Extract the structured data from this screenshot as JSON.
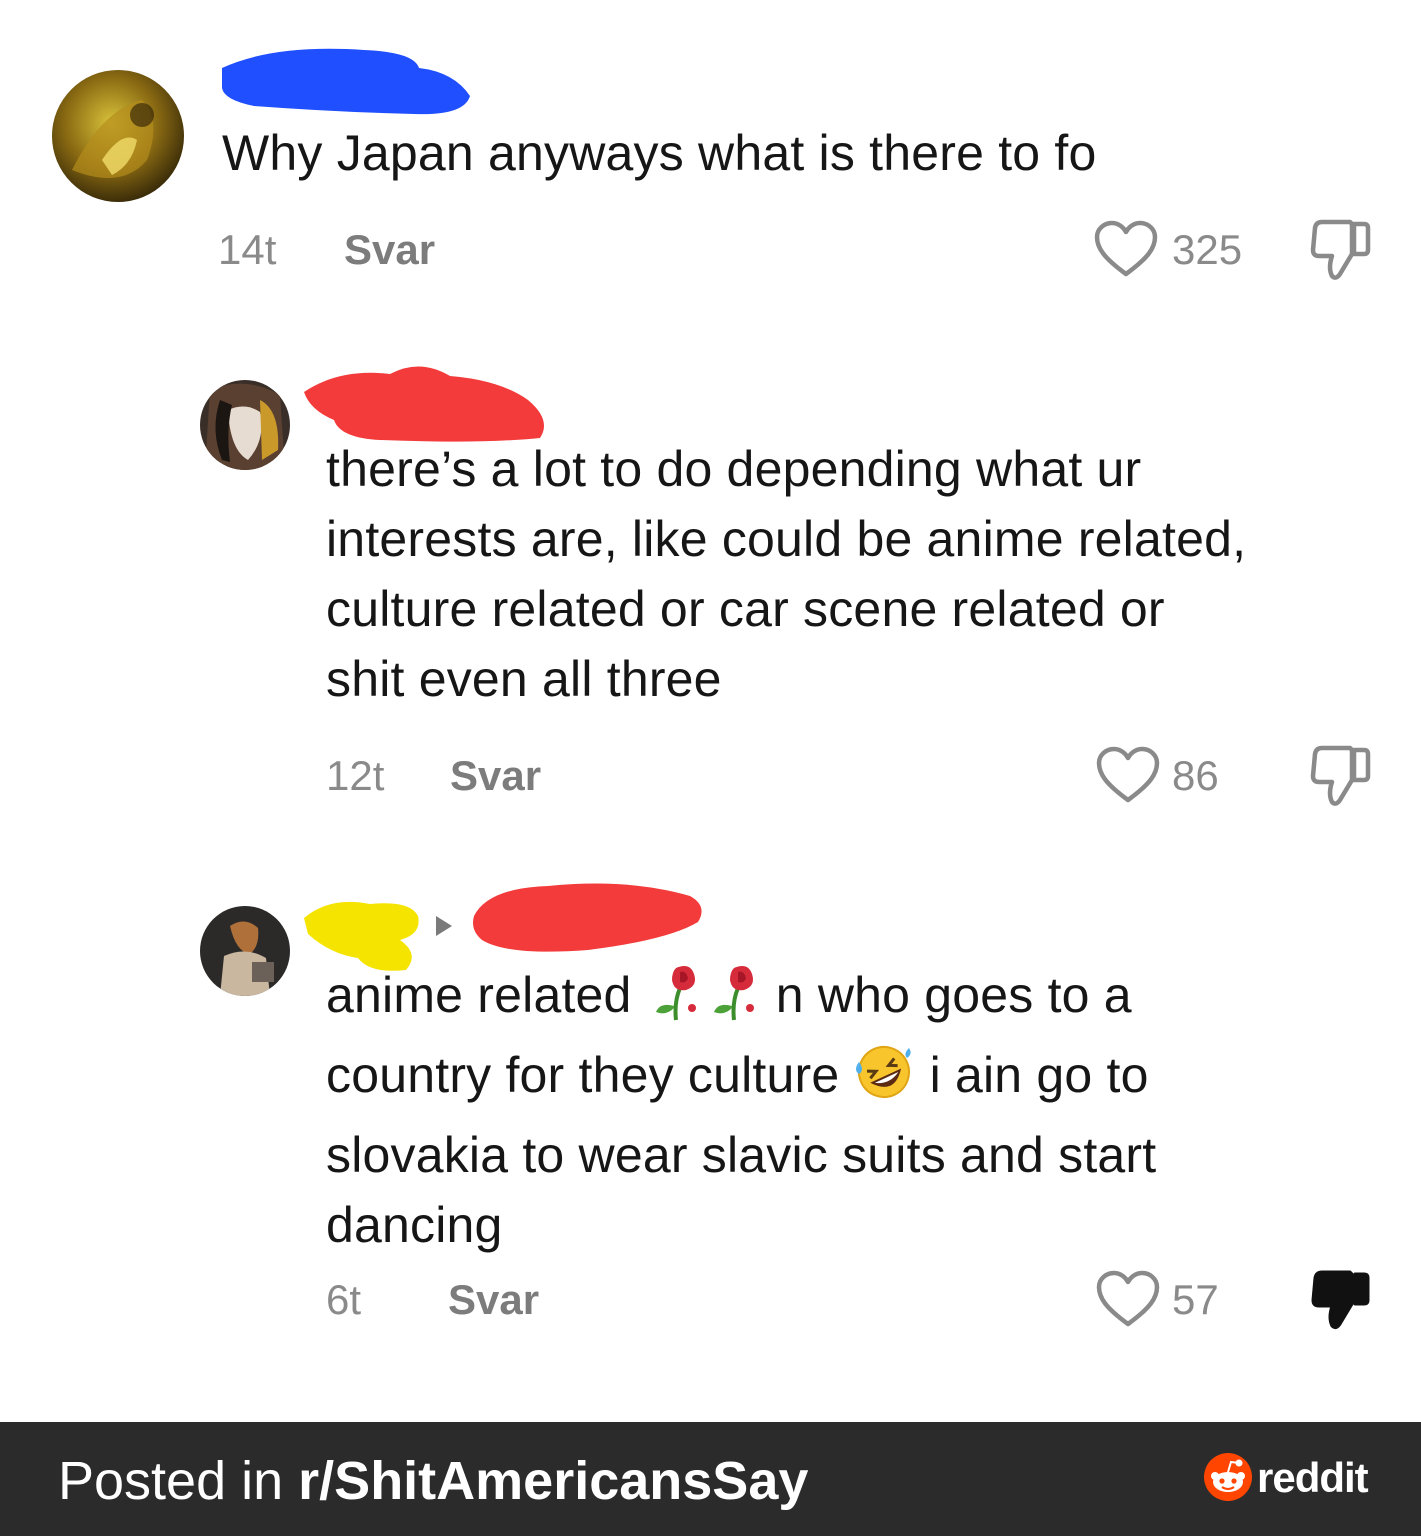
{
  "comments": [
    {
      "lines": [
        "Why Japan anyways what is there to fo"
      ],
      "time": "14t",
      "reply_label": "Svar",
      "likes": "325",
      "disliked": false,
      "scribble_colors": [
        "#1f4fff"
      ]
    },
    {
      "lines": [
        "there’s a lot to do depending what ur",
        "interests are, like could be anime related,",
        "culture related or car scene related or",
        "shit even all three"
      ],
      "time": "12t",
      "reply_label": "Svar",
      "likes": "86",
      "disliked": false,
      "scribble_colors": [
        "#f43b3b"
      ]
    },
    {
      "line1_a": "anime related",
      "line1_b": "n who goes to a",
      "line2_a": "country for they culture",
      "line2_b": "i ain go to",
      "line3": "slovakia to wear slavic suits and start",
      "line4": "dancing",
      "time": "6t",
      "reply_label": "Svar",
      "likes": "57",
      "disliked": true,
      "scribble_colors": [
        "#f5e400",
        "#f43b3b"
      ]
    }
  ],
  "footer": {
    "prefix": "Posted in ",
    "subreddit": "r/ShitAmericansSay",
    "brand": "reddit",
    "brand_color": "#ff4500",
    "background": "#2b2b2b"
  }
}
